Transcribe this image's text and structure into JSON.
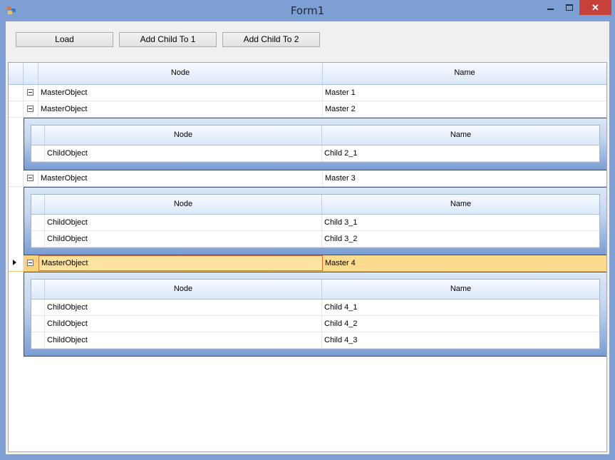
{
  "window": {
    "title": "Form1"
  },
  "toolbar": {
    "load": "Load",
    "add1": "Add Child To 1",
    "add2": "Add Child To 2"
  },
  "columns": {
    "node": "Node",
    "name": "Name"
  },
  "rows": [
    {
      "node": "MasterObject",
      "name": "Master 1"
    },
    {
      "node": "MasterObject",
      "name": "Master 2"
    },
    {
      "node": "MasterObject",
      "name": "Master 3"
    },
    {
      "node": "MasterObject",
      "name": "Master 4"
    }
  ],
  "details": {
    "m2": [
      {
        "node": "ChildObject",
        "name": "Child 2_1"
      }
    ],
    "m3": [
      {
        "node": "ChildObject",
        "name": "Child 3_1"
      },
      {
        "node": "ChildObject",
        "name": "Child 3_2"
      }
    ],
    "m4": [
      {
        "node": "ChildObject",
        "name": "Child 4_1"
      },
      {
        "node": "ChildObject",
        "name": "Child 4_2"
      },
      {
        "node": "ChildObject",
        "name": "Child 4_3"
      }
    ]
  },
  "window_controls": {
    "close": "✕"
  },
  "colors": {
    "titlebar": "#7d9fd3",
    "close": "#c7413a",
    "selection": "#fddb8e"
  }
}
